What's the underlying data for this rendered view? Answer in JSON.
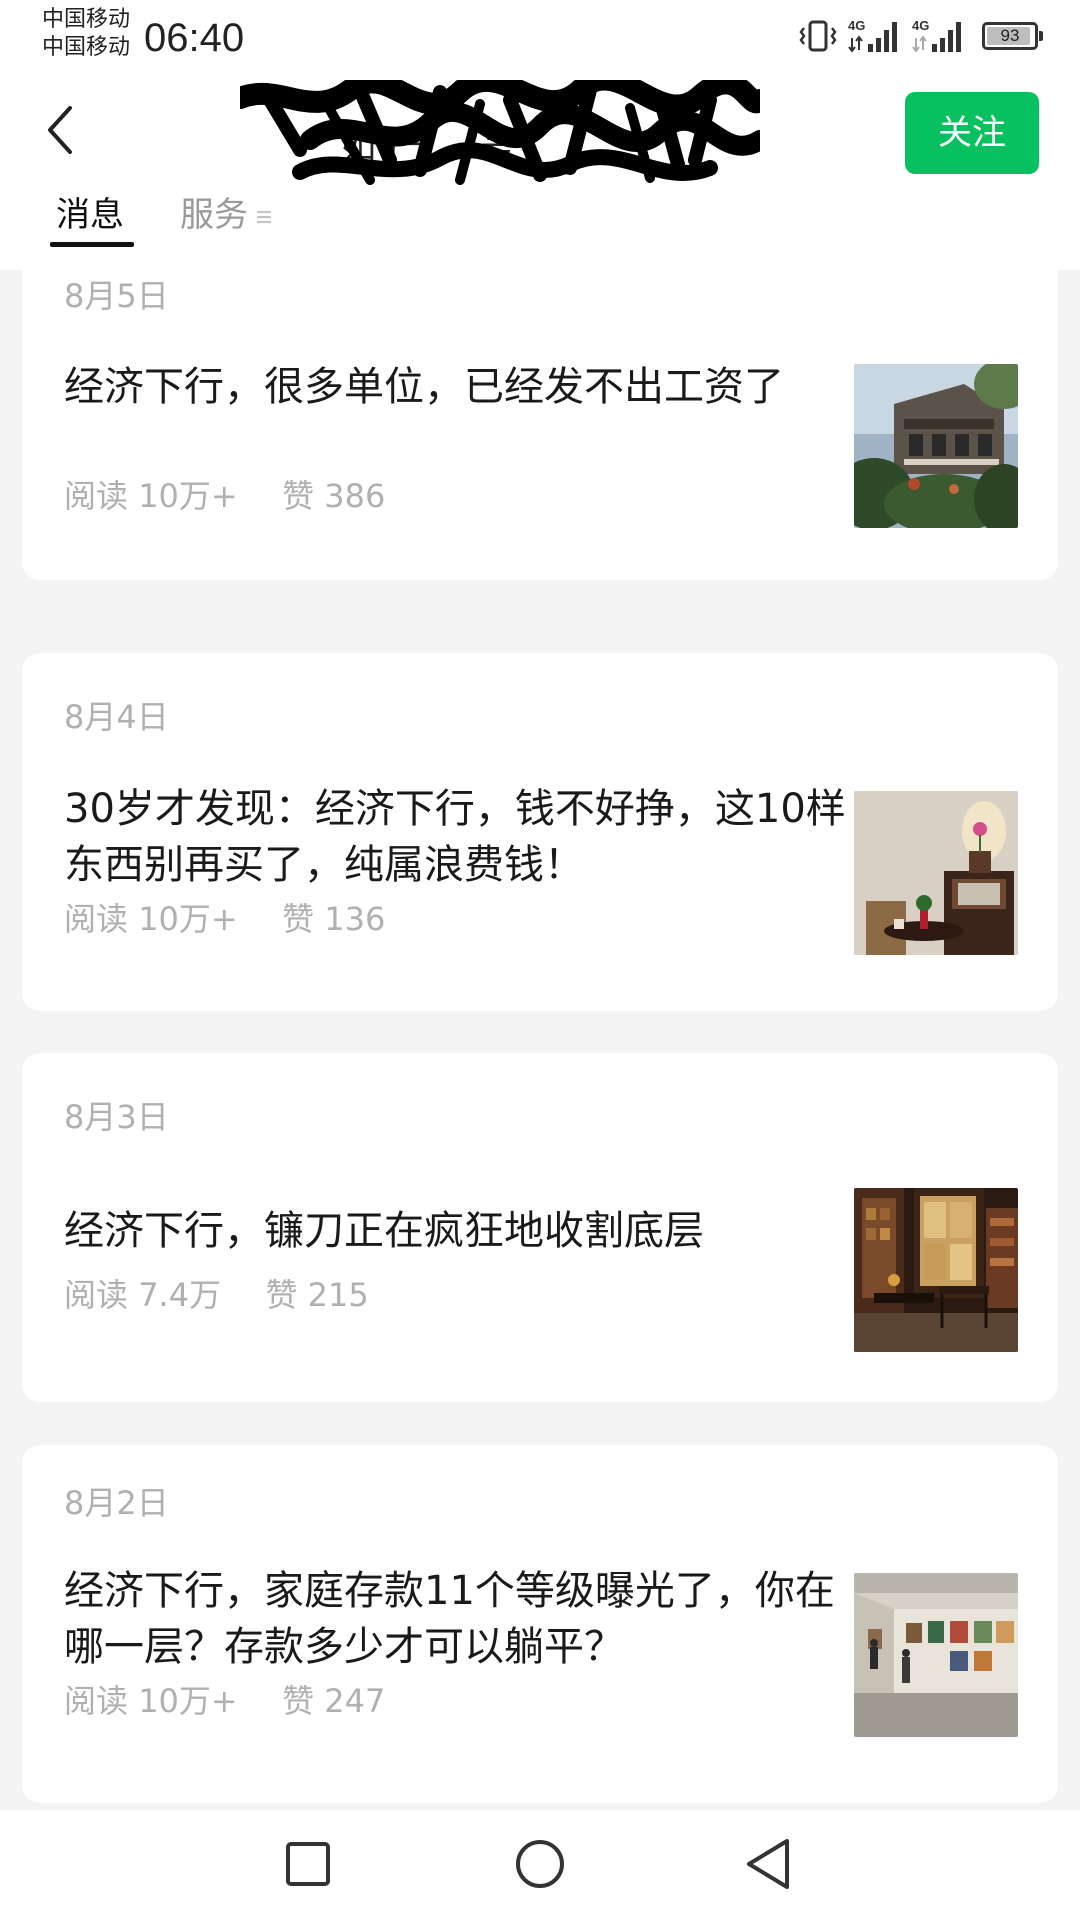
{
  "status_bar": {
    "carrier_1": "中国移动",
    "carrier_2": "中国移动",
    "time": "06:40",
    "network_1": "4G",
    "network_2": "4G",
    "battery_percent": "93",
    "battery_level": 0.93,
    "icons": [
      "vibrate-icon",
      "signal-icon",
      "signal-icon",
      "battery-icon"
    ]
  },
  "header": {
    "back_icon": "chevron-left-icon",
    "title": "如 产 ... 号",
    "follow_label": "关注",
    "accent_color": "#07c160"
  },
  "tabs": [
    {
      "label": "消息",
      "active": true
    },
    {
      "label": "服务",
      "active": false,
      "icon": "menu-icon"
    }
  ],
  "articles": [
    {
      "date": "8月5日",
      "title": "经济下行，很多单位，已经发不出工资了",
      "read_label": "阅读",
      "reads": "10万+",
      "like_label": "赞",
      "likes": "386",
      "image": "house-photo"
    },
    {
      "date": "8月4日",
      "title": "30岁才发现：经济下行，钱不好挣，这10样东西别再买了，纯属浪费钱！",
      "read_label": "阅读",
      "reads": "10万+",
      "like_label": "赞",
      "likes": "136",
      "image": "interior-photo"
    },
    {
      "date": "8月3日",
      "title": "经济下行，镰刀正在疯狂地收割底层",
      "read_label": "阅读",
      "reads": "7.4万",
      "like_label": "赞",
      "likes": "215",
      "image": "antique-shop-photo"
    },
    {
      "date": "8月2日",
      "title": "经济下行，家庭存款11个等级曝光了，你在哪一层？存款多少才可以躺平？",
      "read_label": "阅读",
      "reads": "10万+",
      "like_label": "赞",
      "likes": "247",
      "image": "gallery-photo"
    }
  ],
  "nav_bar": {
    "icons": [
      "square-recents-icon",
      "circle-home-icon",
      "triangle-back-icon"
    ]
  }
}
